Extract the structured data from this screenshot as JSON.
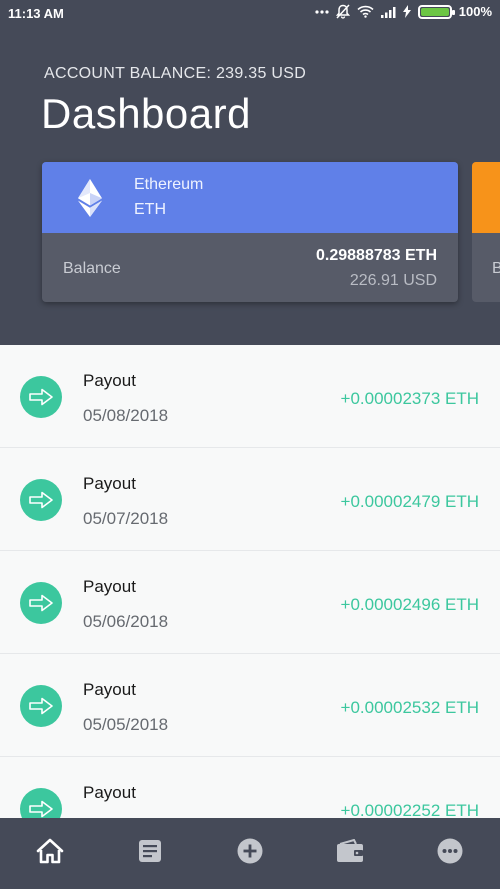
{
  "status_bar": {
    "time": "11:13 AM",
    "battery": "100%",
    "icons": [
      "more-dots-icon",
      "silent-bell-icon",
      "wifi-icon",
      "signal-icon",
      "charging-icon",
      "battery-icon"
    ]
  },
  "header": {
    "account_balance": "ACCOUNT BALANCE: 239.35 USD",
    "title": "Dashboard"
  },
  "wallet_card": {
    "coin_name": "Ethereum",
    "coin_symbol": "ETH",
    "icon": "ethereum-icon",
    "balance_label": "Balance",
    "balance_crypto": "0.29888783 ETH",
    "balance_fiat": "226.91 USD",
    "accent": "#6080e8"
  },
  "next_card": {
    "balance_label": "B",
    "accent": "#f7931a"
  },
  "transactions": [
    {
      "title": "Payout",
      "date": "05/08/2018",
      "amount": "+0.00002373 ETH"
    },
    {
      "title": "Payout",
      "date": "05/07/2018",
      "amount": "+0.00002479 ETH"
    },
    {
      "title": "Payout",
      "date": "05/06/2018",
      "amount": "+0.00002496 ETH"
    },
    {
      "title": "Payout",
      "date": "05/05/2018",
      "amount": "+0.00002532 ETH"
    },
    {
      "title": "Payout",
      "date": "",
      "amount": "+0.00002252 ETH"
    }
  ],
  "bottom_nav": {
    "items": [
      "home-icon",
      "document-icon",
      "add-circle-icon",
      "wallet-icon",
      "more-icon"
    ],
    "active": "home-icon"
  },
  "colors": {
    "header_bg": "#454a58",
    "incoming": "#3cc79e"
  }
}
